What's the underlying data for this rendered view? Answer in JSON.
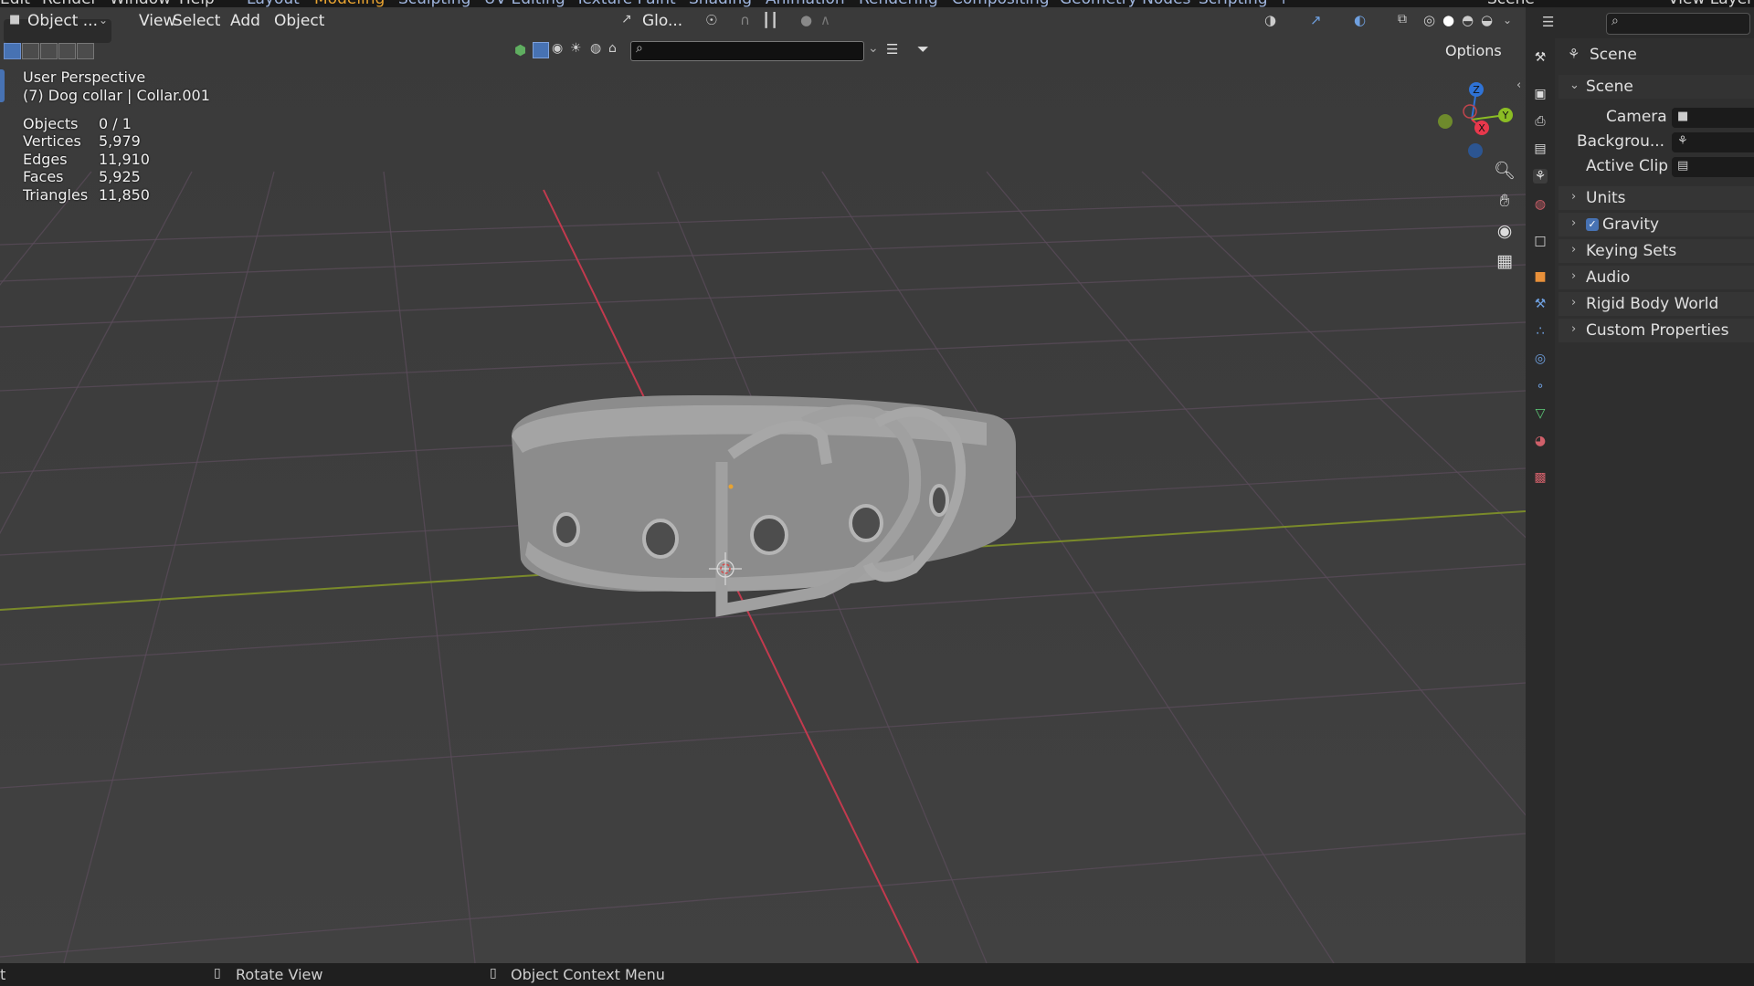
{
  "menus": {
    "items": [
      "Edit",
      "Render",
      "Window",
      "Help"
    ],
    "workspaces": [
      "Layout",
      "Modeling",
      "Sculpting",
      "UV Editing",
      "Texture Paint",
      "Shading",
      "Animation",
      "Rendering",
      "Compositing",
      "Geometry Nodes",
      "Scripting"
    ],
    "add_tab": "+",
    "active_workspace": "Modeling",
    "scene_field": "Scene",
    "view_layer_field": "View Layer"
  },
  "viewport_header": {
    "mode": "Object ...",
    "menus": [
      "View",
      "Select",
      "Add",
      "Object"
    ],
    "transform_orientation": "Glo...",
    "options_label": "Options"
  },
  "overlay": {
    "perspective": "User Perspective",
    "object_line": "(7) Dog collar  | Collar.001",
    "stats": [
      {
        "label": "Objects",
        "value": "0 / 1"
      },
      {
        "label": "Vertices",
        "value": "5,979"
      },
      {
        "label": "Edges",
        "value": "11,910"
      },
      {
        "label": "Faces",
        "value": "5,925"
      },
      {
        "label": "Triangles",
        "value": "11,850"
      }
    ]
  },
  "gizmo": {
    "z": "Z",
    "y": "Y",
    "x": "X",
    "z_color": "#2f73d6",
    "y_color": "#8bbd24",
    "x_color": "#e8384c"
  },
  "properties": {
    "header": "Scene",
    "section": "Scene",
    "camera_label": "Camera",
    "background_label": "Backgrou...",
    "active_clip_label": "Active Clip",
    "subsections": [
      "Units",
      "Gravity",
      "Keying Sets",
      "Audio",
      "Rigid Body World",
      "Custom Properties"
    ],
    "gravity_checked": true
  },
  "status": {
    "left": "t",
    "rotate": "Rotate View",
    "context": "Object Context Menu"
  },
  "colors": {
    "accent_active": "#e8a331",
    "viewport_bg": "#3c3c3c",
    "x_axis_line": "#c23a4e",
    "y_axis_line": "#7a8a2a"
  }
}
